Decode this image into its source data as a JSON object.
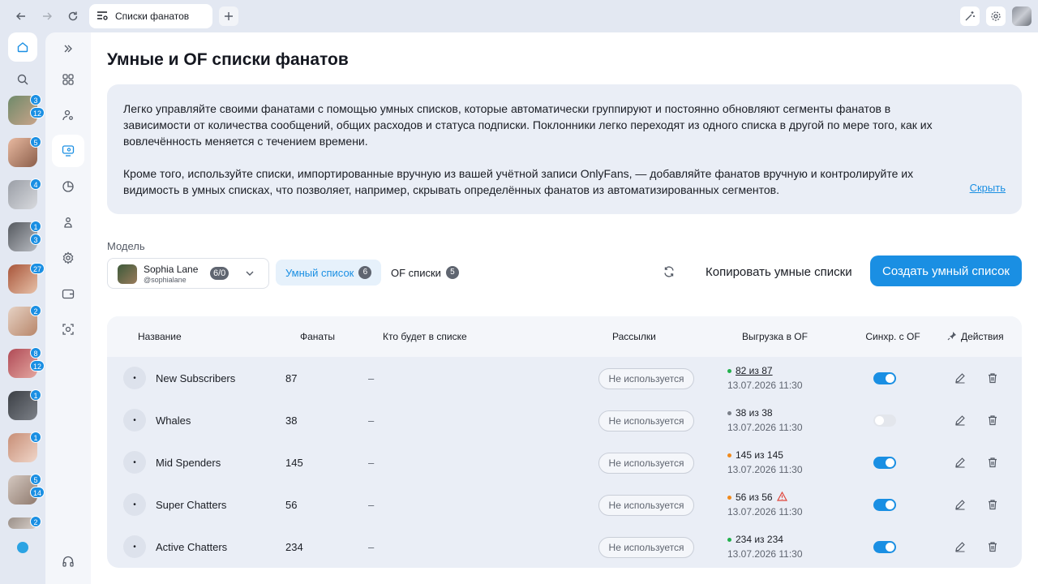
{
  "tab": {
    "title": "Списки фанатов"
  },
  "page": {
    "title": "Умные и OF списки фанатов",
    "info_paragraph_1": "Легко управляйте своими фанатами с помощью умных списков, которые автоматически группируют и постоянно обновляют сегменты фанатов в зависимости от количества сообщений, общих расходов и статуса подписки. Поклонники легко переходят из одного списка в другой по мере того, как их вовлечённость меняется с течением времени.",
    "info_paragraph_2": "Кроме того, используйте списки, импортированные вручную из вашей учётной записи OnlyFans, — добавляйте фанатов вручную и контролируйте их видимость в умных списках, что позволяет, например, скрывать определённых фанатов из автоматизированных сегментов.",
    "hide_label": "Скрыть"
  },
  "rail_avatars": [
    {
      "badges": [
        "3",
        "12"
      ],
      "colors": [
        "#6f8a6a",
        "#c9a48a"
      ]
    },
    {
      "badges": [
        "5"
      ],
      "colors": [
        "#e8b9a0",
        "#8b5e4a"
      ]
    },
    {
      "badges": [
        "4"
      ],
      "colors": [
        "#9a9ea6",
        "#d8dade"
      ]
    },
    {
      "badges": [
        "1",
        "3"
      ],
      "colors": [
        "#55595f",
        "#b9bcc2"
      ]
    },
    {
      "badges": [
        "27"
      ],
      "colors": [
        "#a8553a",
        "#e7c1a8"
      ]
    },
    {
      "badges": [
        "2"
      ],
      "colors": [
        "#e6d2c4",
        "#b8866a"
      ]
    },
    {
      "badges": [
        "8",
        "12"
      ],
      "colors": [
        "#b04a56",
        "#e4a7a0"
      ]
    },
    {
      "badges": [
        "1"
      ],
      "colors": [
        "#3b3f45",
        "#7d8188"
      ]
    },
    {
      "badges": [
        "1"
      ],
      "colors": [
        "#c78e76",
        "#f0d6c9"
      ]
    },
    {
      "badges": [
        "5",
        "14"
      ],
      "colors": [
        "#d4c8c0",
        "#8f7a6e"
      ]
    },
    {
      "badges": [
        "2"
      ],
      "colors": [
        "#9a8f88",
        "#d8d0ca"
      ]
    }
  ],
  "model": {
    "label": "Модель",
    "name": "Sophia Lane",
    "handle": "@sophialane",
    "count": "6/0"
  },
  "segments": {
    "smart_label": "Умный список",
    "smart_count": "6",
    "of_label": "OF списки",
    "of_count": "5"
  },
  "actions": {
    "copy_label": "Копировать умные списки",
    "create_label": "Создать умный список"
  },
  "table": {
    "headers": {
      "name": "Название",
      "fans": "Фанаты",
      "who": "Кто будет в списке",
      "mailings": "Рассылки",
      "export": "Выгрузка в OF",
      "sync": "Синхр. с OF",
      "actions": "Действия"
    },
    "rows": [
      {
        "name": "New Subscribers",
        "fans": "87",
        "who": "–",
        "mailing": "Не используется",
        "export_count": "82 из 87",
        "export_date": "13.07.2026 11:30",
        "status_color": "#22b14c",
        "warning": false,
        "sync": true
      },
      {
        "name": "Whales",
        "fans": "38",
        "who": "–",
        "mailing": "Не используется",
        "export_count": "38 из 38",
        "export_date": "13.07.2026 11:30",
        "status_color": "#7a7f88",
        "warning": false,
        "sync": false
      },
      {
        "name": "Mid Spenders",
        "fans": "145",
        "who": "–",
        "mailing": "Не используется",
        "export_count": "145 из 145",
        "export_date": "13.07.2026 11:30",
        "status_color": "#f08a1c",
        "warning": false,
        "sync": true
      },
      {
        "name": "Super Chatters",
        "fans": "56",
        "who": "–",
        "mailing": "Не используется",
        "export_count": "56 из 56",
        "export_date": "13.07.2026 11:30",
        "status_color": "#f08a1c",
        "warning": true,
        "sync": true
      },
      {
        "name": "Active Chatters",
        "fans": "234",
        "who": "–",
        "mailing": "Не используется",
        "export_count": "234 из 234",
        "export_date": "13.07.2026 11:30",
        "status_color": "#22b14c",
        "warning": false,
        "sync": true
      }
    ]
  }
}
